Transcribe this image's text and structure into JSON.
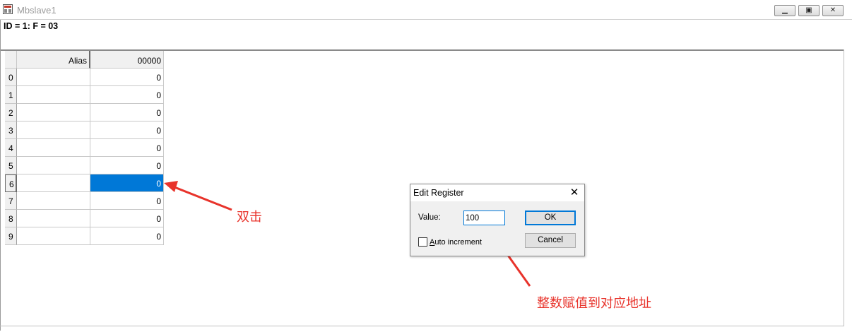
{
  "window": {
    "title": "Mbslave1"
  },
  "status": {
    "text": "ID = 1: F = 03"
  },
  "grid": {
    "alias_header": "Alias",
    "address_header": "00000",
    "rows": [
      {
        "index": "0",
        "value": "0"
      },
      {
        "index": "1",
        "value": "0"
      },
      {
        "index": "2",
        "value": "0"
      },
      {
        "index": "3",
        "value": "0"
      },
      {
        "index": "4",
        "value": "0"
      },
      {
        "index": "5",
        "value": "0"
      },
      {
        "index": "6",
        "value": "0"
      },
      {
        "index": "7",
        "value": "0"
      },
      {
        "index": "8",
        "value": "0"
      },
      {
        "index": "9",
        "value": "0"
      }
    ],
    "selected_row": 6
  },
  "dialog": {
    "title": "Edit Register",
    "value_label": "Value:",
    "value": "100",
    "ok_label": "OK",
    "cancel_label": "Cancel",
    "auto_increment_label": "Auto increment",
    "auto_increment_checked": false
  },
  "annotations": {
    "double_click": "双击",
    "assign_value": "整数赋值到对应地址",
    "color": "#e8332b"
  },
  "colors": {
    "selection": "#0078d7"
  }
}
